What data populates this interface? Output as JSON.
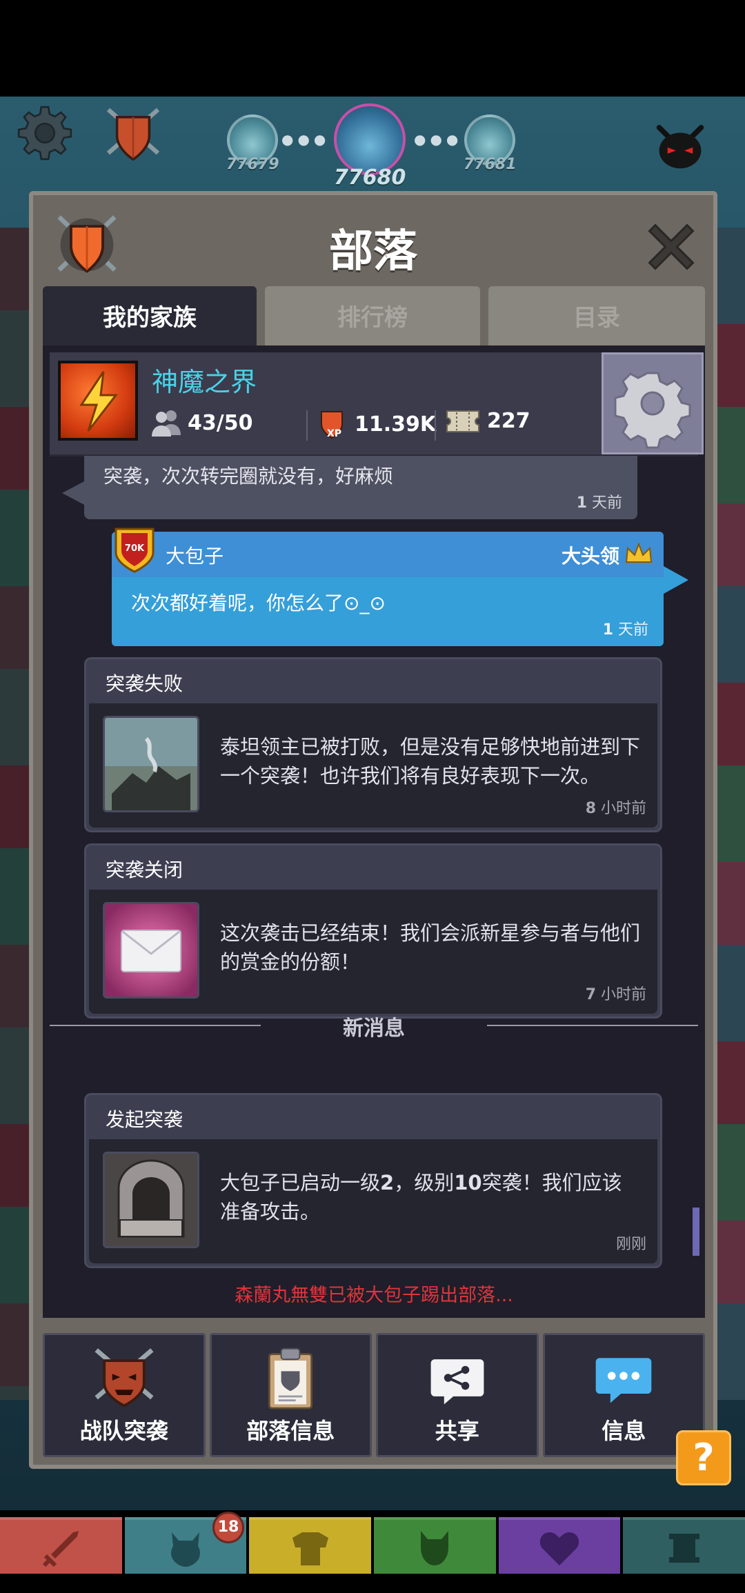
{
  "hud": {
    "levels": [
      "77679",
      "77680",
      "77681"
    ],
    "current_level": "77680"
  },
  "modal": {
    "title": "部落",
    "tabs": [
      {
        "label": "我的家族",
        "active": true
      },
      {
        "label": "排行榜",
        "active": false
      },
      {
        "label": "目录",
        "active": false
      }
    ]
  },
  "clan": {
    "name": "神魔之界",
    "members": "43/50",
    "xp": "11.39K",
    "tickets": "227"
  },
  "chat": {
    "gray_message": {
      "text": "突袭，次次转完圈就没有，好麻烦",
      "time_num": "1",
      "time_unit": " 天前"
    },
    "blue_message": {
      "badge": "70K",
      "sender": "大包子",
      "role": "大头领",
      "text": "次次都好着呢，你怎么了⊙_⊙",
      "time_num": "1",
      "time_unit": " 天前"
    },
    "cards": [
      {
        "title": "突袭失败",
        "text": "泰坦领主已被打败，但是没有足够快地前进到下一个突袭！也许我们将有良好表现下一次。",
        "time_num": "8",
        "time_unit": " 小时前",
        "icon": "titan-defeated-image"
      },
      {
        "title": "突袭关闭",
        "text": "这次袭击已经结束！我们会派新星参与者与他们的赏金的份额！",
        "time_num": "7",
        "time_unit": " 小时前",
        "icon": "mail-icon"
      }
    ],
    "new_messages_label": "新消息",
    "new_card": {
      "title": "发起突袭",
      "text_a": "大包子已启动一级",
      "text_b": "2",
      "text_c": "，级别",
      "text_d": "10",
      "text_e": "突袭！我们应该准备攻击。",
      "time": "刚刚",
      "icon": "raid-gate-image"
    },
    "kick_notice": "森蘭丸無雙已被大包子踢出部落..."
  },
  "actions": [
    {
      "label": "战队突袭",
      "icon": "raid-mask-icon"
    },
    {
      "label": "部落信息",
      "icon": "clipboard-icon"
    },
    {
      "label": "共享",
      "icon": "share-icon"
    },
    {
      "label": "信息",
      "icon": "chat-bubble-icon"
    }
  ],
  "help_label": "?",
  "bottom_nav": {
    "badge_count": "18",
    "tabs": [
      "sword-icon",
      "hero-icon",
      "armor-icon",
      "pet-icon",
      "heart-icon",
      "artifact-icon"
    ],
    "colors": [
      "#c0524a",
      "#3f7f88",
      "#c9ae2a",
      "#3f8a3a",
      "#6a3fa0",
      "#2f5f60"
    ]
  },
  "colors": {
    "accent_cyan": "#4ad2e8",
    "message_blue": "#359fd9",
    "kick_red": "#e0343a",
    "help_orange": "#f39a1b"
  }
}
